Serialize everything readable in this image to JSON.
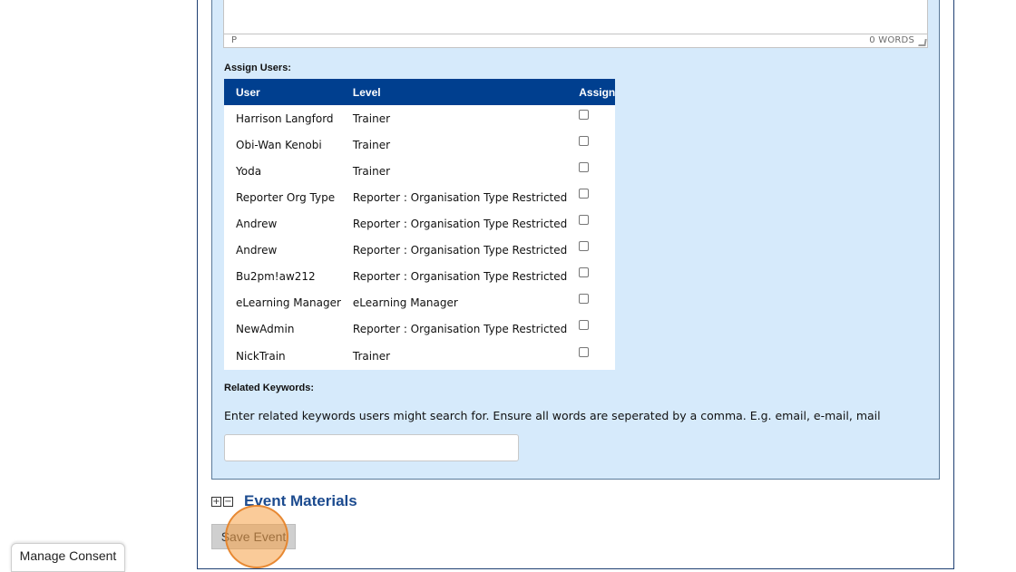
{
  "editor": {
    "path_label": "P",
    "word_count": "0 WORDS"
  },
  "assign_users": {
    "label": "Assign Users:",
    "headers": {
      "user": "User",
      "level": "Level",
      "assign": "Assign"
    },
    "rows": [
      {
        "user": "Harrison Langford",
        "level": "Trainer",
        "assigned": false
      },
      {
        "user": "Obi-Wan Kenobi",
        "level": "Trainer",
        "assigned": false
      },
      {
        "user": "Yoda",
        "level": "Trainer",
        "assigned": false
      },
      {
        "user": "Reporter Org Type",
        "level": "Reporter : Organisation Type Restricted",
        "assigned": false
      },
      {
        "user": "Andrew",
        "level": "Reporter : Organisation Type Restricted",
        "assigned": false
      },
      {
        "user": "Andrew",
        "level": "Reporter : Organisation Type Restricted",
        "assigned": false
      },
      {
        "user": "Bu2pm!aw212",
        "level": "Reporter : Organisation Type Restricted",
        "assigned": false
      },
      {
        "user": "eLearning Manager",
        "level": "eLearning Manager",
        "assigned": false
      },
      {
        "user": "NewAdmin",
        "level": "Reporter : Organisation Type Restricted",
        "assigned": false
      },
      {
        "user": "NickTrain",
        "level": "Trainer",
        "assigned": false
      }
    ]
  },
  "related_keywords": {
    "label": "Related Keywords:",
    "help_text": "Enter related keywords users might search for. Ensure all words are seperated by a comma. E.g. email, e-mail, mail",
    "value": ""
  },
  "event_materials": {
    "title": "Event Materials",
    "expand_icon": "plus-box-icon",
    "collapse_icon": "minus-box-icon"
  },
  "save_button": {
    "label": "Save Event"
  },
  "consent_button": {
    "label": "Manage Consent"
  },
  "colors": {
    "panel_bg": "#d6eafb",
    "table_header": "#003f8f",
    "materials_title": "#1c4b8f",
    "click_highlight": "#f5a046"
  }
}
